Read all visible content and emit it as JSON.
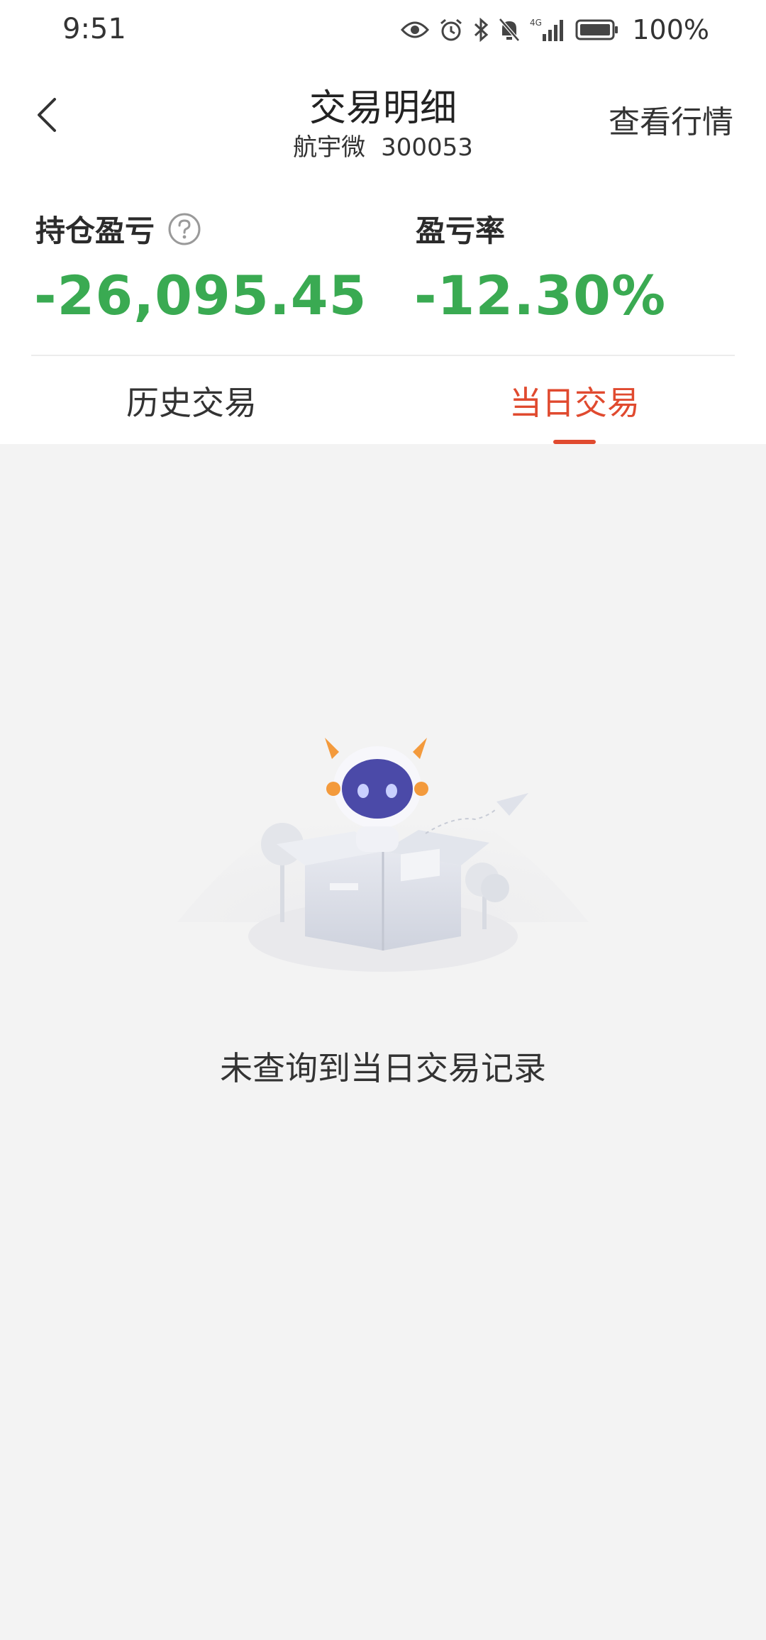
{
  "status_bar": {
    "time": "9:51",
    "battery_percent": "100%",
    "icons": [
      "eye-icon",
      "alarm-icon",
      "bluetooth-icon",
      "mute-bell-icon",
      "signal-4g-icon",
      "battery-icon"
    ]
  },
  "header": {
    "title": "交易明细",
    "stock_name": "航宇微",
    "stock_code": "300053",
    "market_link": "查看行情"
  },
  "stats": {
    "holding_pl_label": "持仓盈亏",
    "holding_pl_value": "-26,095.45",
    "pl_rate_label": "盈亏率",
    "pl_rate_value": "-12.30%"
  },
  "tabs": [
    {
      "label": "历史交易",
      "active": false
    },
    {
      "label": "当日交易",
      "active": true
    }
  ],
  "empty_state": {
    "message": "未查询到当日交易记录"
  },
  "colors": {
    "accent": "#e04a2f",
    "loss_green": "#3aaa52",
    "background": "#f3f3f3"
  }
}
